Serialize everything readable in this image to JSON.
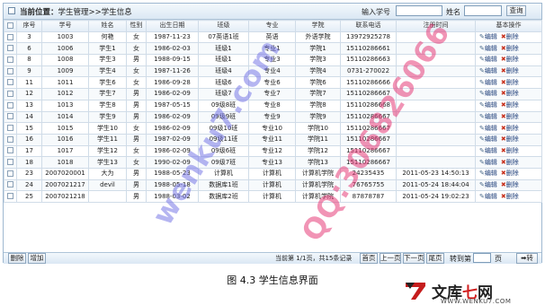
{
  "toolbar": {
    "location_label": "当前位置：",
    "location_path": "学生管理>>学生信息",
    "student_no_label": "输入学号",
    "student_no_value": "",
    "name_label": "姓名",
    "name_value": "",
    "query_button": "查询"
  },
  "table": {
    "columns": [
      "",
      "序号",
      "学号",
      "姓名",
      "性别",
      "出生日期",
      "班级",
      "专业",
      "学院",
      "联系电话",
      "注册时间",
      "基本操作"
    ],
    "rows": [
      [
        "3",
        "1003",
        "何艳",
        "女",
        "1987-11-23",
        "07英语1班",
        "英语",
        "外语学院",
        "13972925278",
        ""
      ],
      [
        "6",
        "1006",
        "学生1",
        "女",
        "1986-02-03",
        "班级1",
        "专业1",
        "学院1",
        "15110286661",
        ""
      ],
      [
        "8",
        "1008",
        "学生3",
        "男",
        "1988-09-15",
        "班级1",
        "专业3",
        "学院3",
        "15110286663",
        ""
      ],
      [
        "9",
        "1009",
        "学生4",
        "女",
        "1987-11-26",
        "班级4",
        "专业4",
        "学院4",
        "0731-270022",
        ""
      ],
      [
        "11",
        "1011",
        "学生6",
        "女",
        "1986-09-28",
        "班级6",
        "专业6",
        "学院6",
        "15110286666",
        ""
      ],
      [
        "12",
        "1012",
        "学生7",
        "男",
        "1986-02-09",
        "班级7",
        "专业7",
        "学院7",
        "15110286667",
        ""
      ],
      [
        "13",
        "1013",
        "学生8",
        "男",
        "1987-05-15",
        "09级8班",
        "专业8",
        "学院8",
        "15110286668",
        ""
      ],
      [
        "14",
        "1014",
        "学生9",
        "男",
        "1986-02-09",
        "09级9班",
        "专业9",
        "学院9",
        "15110286667",
        ""
      ],
      [
        "15",
        "1015",
        "学生10",
        "女",
        "1986-02-09",
        "09级10班",
        "专业10",
        "学院10",
        "15110286667",
        ""
      ],
      [
        "16",
        "1016",
        "学生11",
        "男",
        "1987-02-09",
        "09级11班",
        "专业11",
        "学院11",
        "15110286667",
        ""
      ],
      [
        "17",
        "1017",
        "学生12",
        "女",
        "1986-02-09",
        "09级6班",
        "专业12",
        "学院12",
        "15110286667",
        ""
      ],
      [
        "18",
        "1018",
        "学生13",
        "女",
        "1990-02-09",
        "09级7班",
        "专业13",
        "学院13",
        "15110286667",
        ""
      ],
      [
        "23",
        "2007020001",
        "大为",
        "男",
        "1988-05-23",
        "计算机",
        "计算机",
        "计算机学院",
        "24235435",
        "2011-05-23 14:50:13"
      ],
      [
        "24",
        "2007021217",
        "devil",
        "男",
        "1988-05-18",
        "数据库1班",
        "计算机",
        "计算机学院",
        "76765755",
        "2011-05-24 18:44:04"
      ],
      [
        "25",
        "2007021218",
        "",
        "男",
        "1988-03-02",
        "数据库2班",
        "计算机",
        "计算机学院",
        "87878787",
        "2011-05-24 19:02:23"
      ]
    ],
    "edit_label": "编辑",
    "delete_label": "删除"
  },
  "footer": {
    "delete_button": "删除",
    "add_button": "增加",
    "page_info": "当前第 1/1页，共15条记录",
    "first_button": "首页",
    "prev_button": "上一页",
    "next_button": "下一页",
    "last_button": "尾页",
    "goto_label": "转到第",
    "page_input_value": "",
    "page_unit": "页",
    "go_button": "转"
  },
  "caption": "图 4.3  学生信息界面",
  "watermarks": [
    "wenku7.com",
    "QQ:306826066"
  ],
  "logo": {
    "main_a": "文库",
    "main_b": "七",
    "main_c": "网",
    "url": "WWW.WENKU7.COM"
  }
}
